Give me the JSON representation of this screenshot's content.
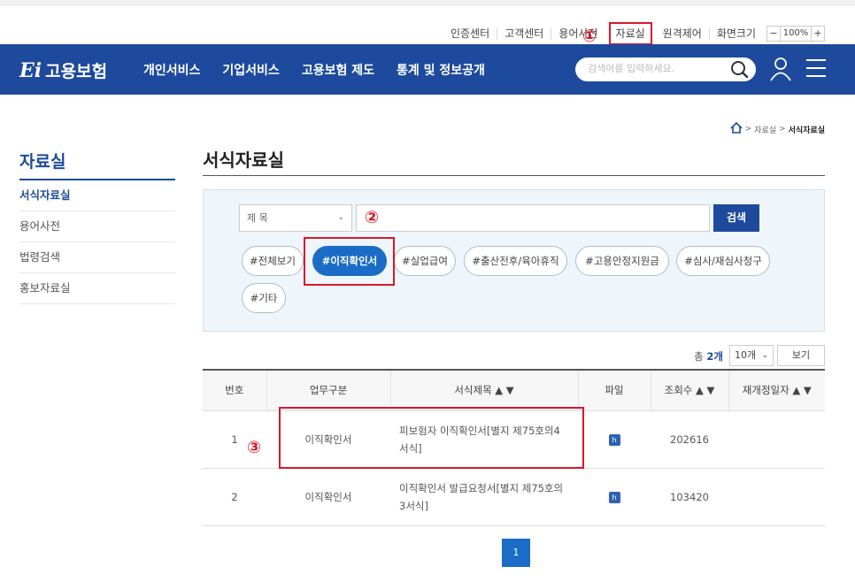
{
  "util": {
    "links": [
      "인증센터",
      "고객센터",
      "용어사전",
      "자료실",
      "원격제어",
      "화면크기"
    ],
    "zoom_minus": "−",
    "zoom_value": "100%",
    "zoom_plus": "+"
  },
  "markers": [
    "①",
    "②",
    "③"
  ],
  "nav": {
    "logo_mark": "Ei",
    "logo_text": "고용보험",
    "menus": [
      "개인서비스",
      "기업서비스",
      "고용보험 제도",
      "통계 및 정보공개"
    ],
    "search_placeholder": "검색어를 입력하세요."
  },
  "breadcrumb": {
    "section": "자료실",
    "current": "서식자료실",
    "sep": ">"
  },
  "sidebar": {
    "title": "자료실",
    "items": [
      "서식자료실",
      "용어사전",
      "법령검색",
      "홍보자료실"
    ]
  },
  "content": {
    "title": "서식자료실",
    "select_value": "제 목",
    "search_button": "검색",
    "tags": [
      "#전체보기",
      "#이직확인서",
      "#실업급여",
      "#출산전후/육아휴직",
      "#고용안정지원금",
      "#심사/재심사청구",
      "#기타"
    ],
    "total_prefix": "총",
    "total_count": "2개",
    "per_page": "10개",
    "view_button": "보기",
    "columns": [
      "번호",
      "업무구분",
      "서식제목 ▲ ▼",
      "파일",
      "조회수 ▲ ▼",
      "재개정일자 ▲ ▼"
    ],
    "rows": [
      {
        "no": "1",
        "category": "이직확인서",
        "title": "피보험자 이직확인서[별지 제75호의4서식]",
        "file": "h",
        "views": "202616",
        "date": ""
      },
      {
        "no": "2",
        "category": "이직확인서",
        "title": "이직확인서 발급요청서[별지 제75호의3서식]",
        "file": "h",
        "views": "103420",
        "date": ""
      }
    ],
    "page": "1"
  },
  "colors": {
    "nav_bg": "#1d4a9c",
    "accent": "#1a6cc6",
    "highlight": "#d8182a"
  }
}
